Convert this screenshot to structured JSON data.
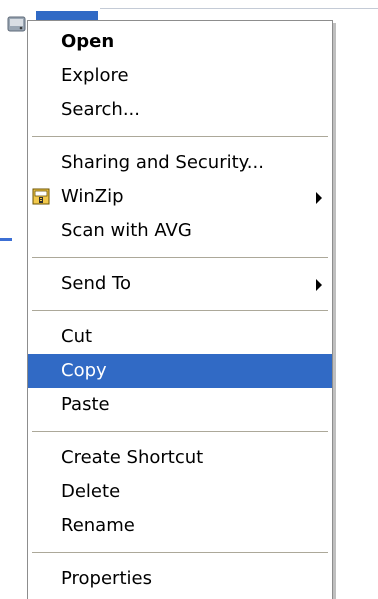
{
  "menu": {
    "items": {
      "open": "Open",
      "explore": "Explore",
      "search": "Search...",
      "sharing": "Sharing and Security...",
      "winzip": "WinZip",
      "scan": "Scan with AVG",
      "send_to": "Send To",
      "cut": "Cut",
      "copy": "Copy",
      "paste": "Paste",
      "create_shortcut": "Create Shortcut",
      "delete": "Delete",
      "rename": "Rename",
      "properties": "Properties"
    },
    "highlighted_item": "Copy",
    "icons": {
      "winzip": "winzip-icon",
      "submenu": "submenu-arrow-icon"
    }
  },
  "colors": {
    "highlight": "#316ac5",
    "separator": "#aca899"
  }
}
